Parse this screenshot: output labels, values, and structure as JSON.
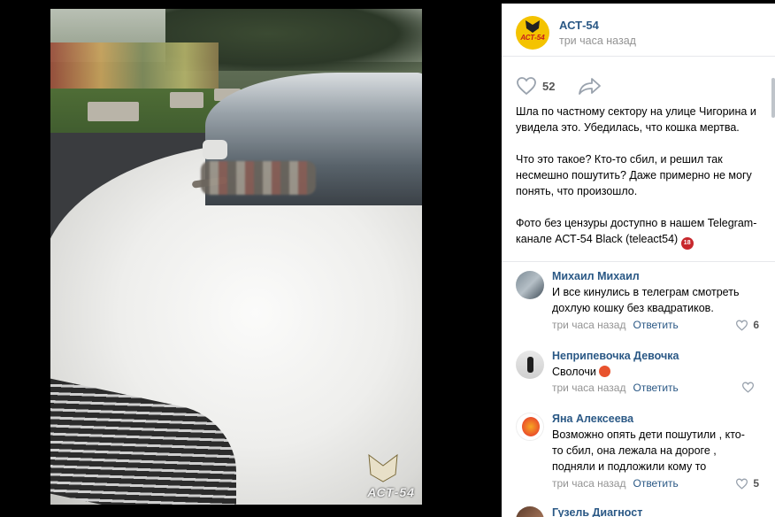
{
  "post": {
    "author": "АСТ-54",
    "time": "три часа назад",
    "likes": "52",
    "text": "Шла по частному сектору на улице Чигорина и увидела это. Убедилась, что кошка мертва.\n\nЧто это такое? Кто-то сбил, и решил так несмешно пошутить? Даже примерно не могу понять, что произошло.\n\nФото без цензуры доступно в нашем Telegram-канале АСТ-54 Black (teleact54)",
    "badge": "18",
    "watermark": "АСТ-54",
    "logo_text": "АСТ-54"
  },
  "comments": [
    {
      "name": "Михаил Михаил",
      "text": "И все кинулись в телеграм смотреть дохлую кошку без квадратиков.",
      "time": "три часа назад",
      "reply": "Ответить",
      "likes": "6"
    },
    {
      "name": "Неприпевочка Девочка",
      "text": "Сволочи",
      "time": "три часа назад",
      "reply": "Ответить",
      "likes": ""
    },
    {
      "name": "Яна Алексеева",
      "text": "Возможно опять дети пошутили , кто-то сбил, она лежала на дороге , подняли и подложили кому то",
      "time": "три часа назад",
      "reply": "Ответить",
      "likes": "5"
    },
    {
      "name": "Гузель Диагност",
      "text": "",
      "time": "",
      "reply": "",
      "likes": ""
    }
  ],
  "colors": {
    "link": "#2a5885",
    "meta": "#939393",
    "brand": "#f4c300"
  }
}
